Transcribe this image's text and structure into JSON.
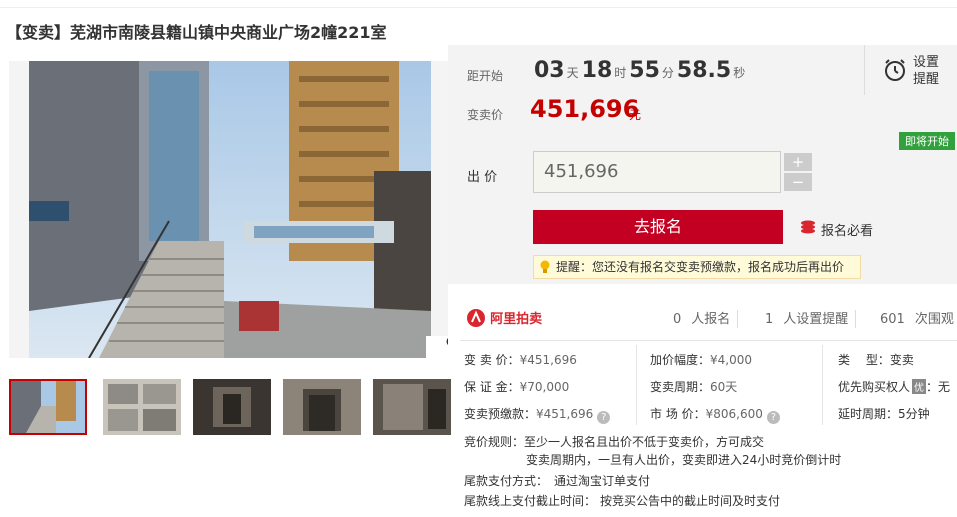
{
  "title": "【变卖】芜湖市南陵县籍山镇中央商业广场2幢221室",
  "gallery": {
    "zoom_icon": "magnifier-icon",
    "thumb_count": 5
  },
  "countdown": {
    "label": "距开始",
    "days": "03",
    "days_unit": "天",
    "hours": "18",
    "hours_unit": "时",
    "minutes": "55",
    "minutes_unit": "分",
    "seconds": "58.5",
    "seconds_unit": "秒"
  },
  "remind": {
    "label": "设置提醒",
    "icon": "alarm-clock-icon"
  },
  "price": {
    "label": "变卖价",
    "value": "451,696",
    "unit": "元"
  },
  "bid": {
    "badge": "即将开始",
    "label": "出 价",
    "input_value": "451,696",
    "plus": "+",
    "minus": "−",
    "signup_button": "去报名",
    "must_read": "报名必看",
    "tip": "提醒：您还没有报名交变卖预缴款，报名成功后再出价"
  },
  "stats": {
    "brand": "阿里拍卖",
    "signed_up_count": "0",
    "signed_up_label": "人报名",
    "remind_count": "1",
    "remind_label": "人设置提醒",
    "views_count": "601",
    "views_label": "次围观"
  },
  "info": {
    "col1": [
      {
        "k": "变 卖 价：",
        "v": "¥451,696"
      },
      {
        "k": "保 证 金：",
        "v": "¥70,000"
      },
      {
        "k": "变卖预缴款：",
        "v": "¥451,696"
      }
    ],
    "col2": [
      {
        "k": "加价幅度：",
        "v": "¥4,000"
      },
      {
        "k": "变卖周期：",
        "v": "60天"
      },
      {
        "k": "市 场 价：",
        "v": "¥806,600"
      }
    ],
    "col3": [
      {
        "k": "类　 型：",
        "v": "变卖"
      },
      {
        "k": "优先购买权人",
        "v": "：无",
        "badge": "优"
      },
      {
        "k": "延时周期：",
        "v": "5分钟"
      }
    ]
  },
  "rules": {
    "line1_k": "竞价规则：",
    "line1_v": "至少一人报名且出价不低于变卖价，方可成交",
    "line2": "变卖周期内，一旦有人出价，变卖即进入24小时竞价倒计时",
    "line3_k": "尾款支付方式：",
    "line3_v": "通过淘宝订单支付",
    "line4_k": "尾款线上支付截止时间：",
    "line4_v": "按竞买公告中的截止时间及时支付"
  },
  "colors": {
    "accent": "#c40022",
    "price": "#c40000",
    "badge_green": "#32a03c"
  }
}
